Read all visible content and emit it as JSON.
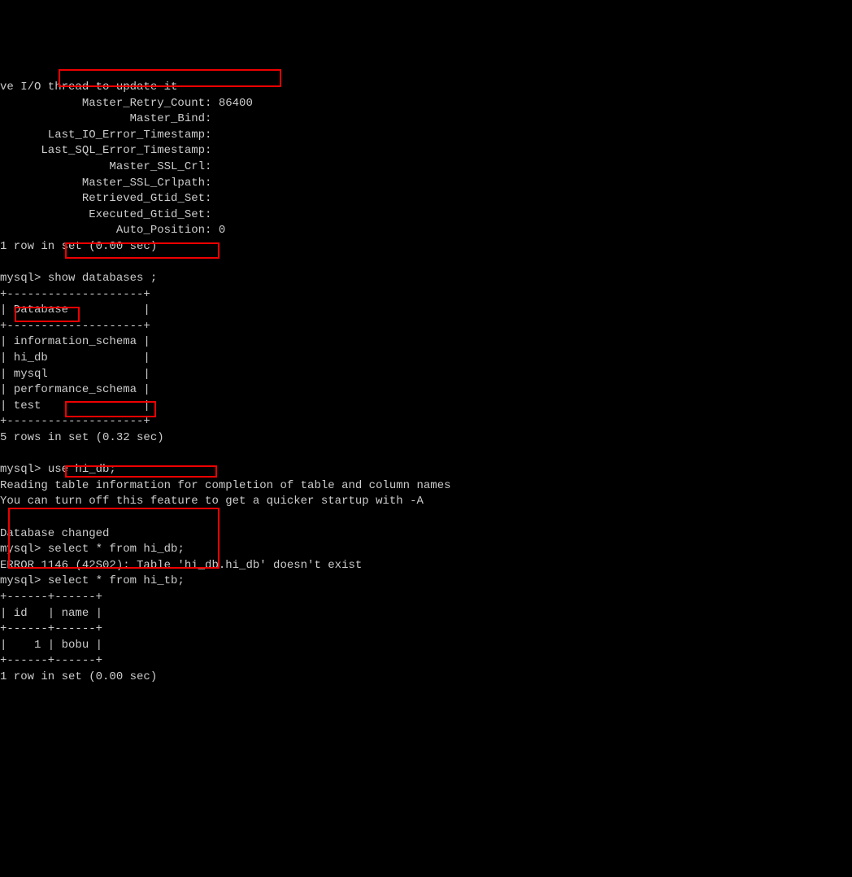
{
  "slave_status": {
    "line1": "ve I/O thread to update it",
    "fields": [
      {
        "label": "Master_Retry_Count",
        "value": "86400"
      },
      {
        "label": "Master_Bind",
        "value": ""
      },
      {
        "label": "Last_IO_Error_Timestamp",
        "value": ""
      },
      {
        "label": "Last_SQL_Error_Timestamp",
        "value": ""
      },
      {
        "label": "Master_SSL_Crl",
        "value": ""
      },
      {
        "label": "Master_SSL_Crlpath",
        "value": ""
      },
      {
        "label": "Retrieved_Gtid_Set",
        "value": ""
      },
      {
        "label": "Executed_Gtid_Set",
        "value": ""
      },
      {
        "label": "Auto_Position",
        "value": "0"
      }
    ],
    "result": "1 row in set (0.00 sec)"
  },
  "prompt": "mysql> ",
  "cmd1": "show databases ;",
  "db_table": {
    "border_top": "+--------------------+",
    "header": "| Database           |",
    "rows": [
      "| information_schema |",
      "| hi_db              |",
      "| mysql              |",
      "| performance_schema |",
      "| test               |"
    ],
    "result": "5 rows in set (0.32 sec)"
  },
  "cmd2": "use hi_db;",
  "use_msg1": "Reading table information for completion of table and column names",
  "use_msg2": "You can turn off this feature to get a quicker startup with -A",
  "use_msg3": "Database changed",
  "cmd3": "select * from hi_db;",
  "error": "ERROR 1146 (42S02): Table 'hi_db.hi_db' doesn't exist",
  "cmd4": "select * from hi_tb;",
  "tb_table": {
    "border": "+------+------+",
    "header": "| id   | name |",
    "row": "|    1 | bobu |",
    "result": "1 row in set (0.00 sec)"
  }
}
